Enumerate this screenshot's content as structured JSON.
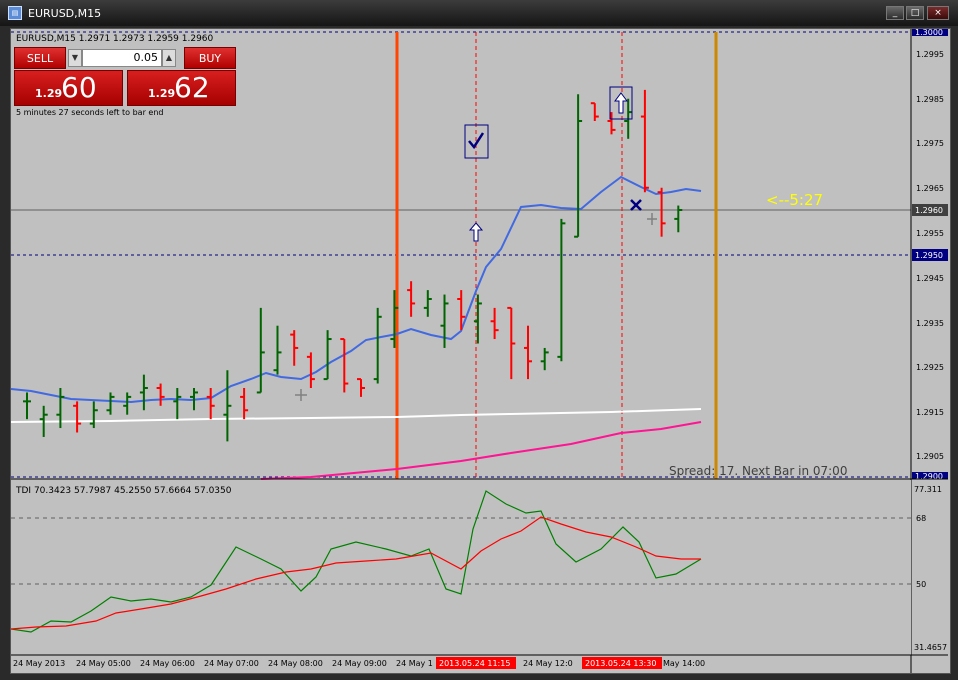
{
  "window": {
    "title": "EURUSD,M15",
    "min_label": "_",
    "max_label": "□",
    "close_label": "×"
  },
  "chart_info": "EURUSD,M15  1.2971 1.2973 1.2959 1.2960",
  "order_panel": {
    "sell_label": "SELL",
    "buy_label": "BUY",
    "lot": "0.05",
    "sell_price_prefix": "1.29",
    "sell_price_main": "60",
    "buy_price_prefix": "1.29",
    "buy_price_main": "62"
  },
  "bar_timer": "5 minutes 27 seconds left to bar end",
  "countdown_label": "<--5:27",
  "spread_label": "Spread: 17. Next Bar in 07:00",
  "price_axis": {
    "ticks": [
      "1.2995",
      "1.2985",
      "1.2975",
      "1.2965",
      "1.2955",
      "1.2945",
      "1.2935",
      "1.2925",
      "1.2915",
      "1.2905"
    ],
    "top_label": "1.3000",
    "current_price": "1.2960",
    "level_price": "1.2950",
    "bottom_label": "1.2900"
  },
  "indicator": {
    "label": "TDI 70.3423 57.7987 45.2550 57.6664 57.0350",
    "levels": [
      "77.311",
      "68",
      "50",
      "31.4657"
    ]
  },
  "time_axis": {
    "labels": [
      "24 May 2013",
      "24 May 05:00",
      "24 May 06:00",
      "24 May 07:00",
      "24 May 08:00",
      "24 May 09:00",
      "24 May 1",
      "May 14:00",
      "24 May 12:0"
    ],
    "marker1": "2013.05.24 11:15",
    "marker2": "2013.05.24 13:30"
  },
  "colors": {
    "up_bar": "#006400",
    "down_bar": "#ff0000",
    "ma_blue": "#4169e1",
    "ma_white": "#ffffff",
    "ma_pink": "#ff1493",
    "vline_orange": "#ff4500",
    "vline_gold": "#cc8800",
    "price_tag_bg": "#000080",
    "time_marker_bg": "#ff0000",
    "countdown": "#ffff00"
  },
  "icons": [
    "check-icon",
    "up-arrow-icon",
    "cross-icon"
  ],
  "chart_data": {
    "type": "ohlc",
    "timeframe": "M15",
    "bars": [
      {
        "t": "04:15",
        "o": 1.2917,
        "h": 1.2919,
        "l": 1.2913,
        "c": 1.2917
      },
      {
        "t": "04:30",
        "o": 1.2913,
        "h": 1.2916,
        "l": 1.2909,
        "c": 1.2914
      },
      {
        "t": "04:45",
        "o": 1.2914,
        "h": 1.292,
        "l": 1.2911,
        "c": 1.2918
      },
      {
        "t": "05:00",
        "o": 1.2916,
        "h": 1.2917,
        "l": 1.291,
        "c": 1.2912
      },
      {
        "t": "05:15",
        "o": 1.2912,
        "h": 1.2917,
        "l": 1.2911,
        "c": 1.2915
      },
      {
        "t": "05:30",
        "o": 1.2915,
        "h": 1.2919,
        "l": 1.2914,
        "c": 1.2918
      },
      {
        "t": "05:45",
        "o": 1.2916,
        "h": 1.2919,
        "l": 1.2914,
        "c": 1.2918
      },
      {
        "t": "06:00",
        "o": 1.2919,
        "h": 1.2923,
        "l": 1.2915,
        "c": 1.292
      },
      {
        "t": "06:15",
        "o": 1.292,
        "h": 1.2921,
        "l": 1.2916,
        "c": 1.2918
      },
      {
        "t": "06:30",
        "o": 1.2917,
        "h": 1.292,
        "l": 1.2913,
        "c": 1.2918
      },
      {
        "t": "06:45",
        "o": 1.2918,
        "h": 1.292,
        "l": 1.2915,
        "c": 1.2919
      },
      {
        "t": "07:00",
        "o": 1.2918,
        "h": 1.292,
        "l": 1.2913,
        "c": 1.2916
      },
      {
        "t": "07:15",
        "o": 1.2914,
        "h": 1.2924,
        "l": 1.2908,
        "c": 1.2916
      },
      {
        "t": "07:30",
        "o": 1.2918,
        "h": 1.292,
        "l": 1.2913,
        "c": 1.2915
      },
      {
        "t": "07:45",
        "o": 1.2919,
        "h": 1.2938,
        "l": 1.2919,
        "c": 1.2928
      },
      {
        "t": "08:00",
        "o": 1.2924,
        "h": 1.2934,
        "l": 1.2923,
        "c": 1.2928
      },
      {
        "t": "08:15",
        "o": 1.2932,
        "h": 1.2933,
        "l": 1.2925,
        "c": 1.2929
      },
      {
        "t": "08:30",
        "o": 1.2927,
        "h": 1.2928,
        "l": 1.292,
        "c": 1.2922
      },
      {
        "t": "08:45",
        "o": 1.2922,
        "h": 1.2933,
        "l": 1.2922,
        "c": 1.2931
      },
      {
        "t": "09:00",
        "o": 1.2931,
        "h": 1.2931,
        "l": 1.2919,
        "c": 1.2921
      },
      {
        "t": "09:15",
        "o": 1.2922,
        "h": 1.2922,
        "l": 1.2918,
        "c": 1.292
      },
      {
        "t": "09:30",
        "o": 1.2922,
        "h": 1.2938,
        "l": 1.2921,
        "c": 1.2936
      },
      {
        "t": "09:45",
        "o": 1.2931,
        "h": 1.2942,
        "l": 1.2929,
        "c": 1.2938
      },
      {
        "t": "10:00",
        "o": 1.2942,
        "h": 1.2944,
        "l": 1.2936,
        "c": 1.2939
      },
      {
        "t": "10:15",
        "o": 1.2938,
        "h": 1.2942,
        "l": 1.2936,
        "c": 1.294
      },
      {
        "t": "10:30",
        "o": 1.2934,
        "h": 1.2941,
        "l": 1.2929,
        "c": 1.2939
      },
      {
        "t": "10:45",
        "o": 1.294,
        "h": 1.2942,
        "l": 1.2933,
        "c": 1.2936
      },
      {
        "t": "11:00",
        "o": 1.2935,
        "h": 1.2941,
        "l": 1.293,
        "c": 1.2939
      },
      {
        "t": "11:15",
        "o": 1.2935,
        "h": 1.2938,
        "l": 1.2931,
        "c": 1.2933
      },
      {
        "t": "11:30",
        "o": 1.2938,
        "h": 1.2938,
        "l": 1.2922,
        "c": 1.293
      },
      {
        "t": "11:45",
        "o": 1.2929,
        "h": 1.2934,
        "l": 1.2922,
        "c": 1.2926
      },
      {
        "t": "12:00",
        "o": 1.2926,
        "h": 1.2929,
        "l": 1.2924,
        "c": 1.2928
      },
      {
        "t": "12:15",
        "o": 1.2927,
        "h": 1.2958,
        "l": 1.2926,
        "c": 1.2957
      },
      {
        "t": "12:30",
        "o": 1.2954,
        "h": 1.2986,
        "l": 1.2954,
        "c": 1.298
      },
      {
        "t": "12:45",
        "o": 1.2984,
        "h": 1.2984,
        "l": 1.298,
        "c": 1.2981
      },
      {
        "t": "13:00",
        "o": 1.298,
        "h": 1.2982,
        "l": 1.2977,
        "c": 1.2978
      },
      {
        "t": "13:15",
        "o": 1.298,
        "h": 1.2985,
        "l": 1.2976,
        "c": 1.2982
      },
      {
        "t": "13:30",
        "o": 1.2981,
        "h": 1.2987,
        "l": 1.2964,
        "c": 1.2965
      },
      {
        "t": "13:45",
        "o": 1.2964,
        "h": 1.2965,
        "l": 1.2954,
        "c": 1.2957
      },
      {
        "t": "14:00",
        "o": 1.2958,
        "h": 1.2961,
        "l": 1.2955,
        "c": 1.296
      }
    ],
    "moving_averages": [
      {
        "name": "blue",
        "values": [
          1.2921,
          1.292,
          1.2919,
          1.2918,
          1.2917,
          1.2917,
          1.2917,
          1.2918,
          1.2919,
          1.2918,
          1.2918,
          1.2918,
          1.2918,
          1.2918,
          1.292,
          1.2922,
          1.2924,
          1.2925,
          1.2925,
          1.2924,
          1.2924,
          1.2926,
          1.2929,
          1.2931,
          1.2932,
          1.2933,
          1.2933,
          1.2934,
          1.2933,
          1.2932,
          1.2931,
          1.2934,
          1.2941,
          1.295,
          1.2958,
          1.2962,
          1.2964,
          1.2963,
          1.2962,
          1.2961
        ]
      },
      {
        "name": "white",
        "values": [
          1.2913,
          1.2914,
          1.2915,
          1.2916
        ]
      },
      {
        "name": "pink",
        "values": [
          1.29,
          1.2903,
          1.2907,
          1.2911
        ]
      }
    ],
    "tdi": {
      "green": [
        37,
        36,
        38,
        37,
        39,
        45,
        47,
        48,
        50,
        51,
        54,
        58,
        61,
        59,
        57,
        63,
        64,
        62,
        59,
        66,
        67,
        65,
        64,
        70,
        73,
        74,
        72,
        68,
        65,
        63,
        61,
        58
      ],
      "red": [
        37,
        37,
        38,
        39,
        40,
        42,
        44,
        46,
        48,
        49,
        52,
        54,
        56,
        57,
        58,
        60,
        61,
        62,
        61,
        62,
        63,
        64,
        63,
        62,
        65,
        68,
        70,
        69,
        67,
        65,
        63,
        60
      ],
      "range": [
        31.4657,
        77.311
      ],
      "levels": [
        68,
        50
      ]
    }
  }
}
